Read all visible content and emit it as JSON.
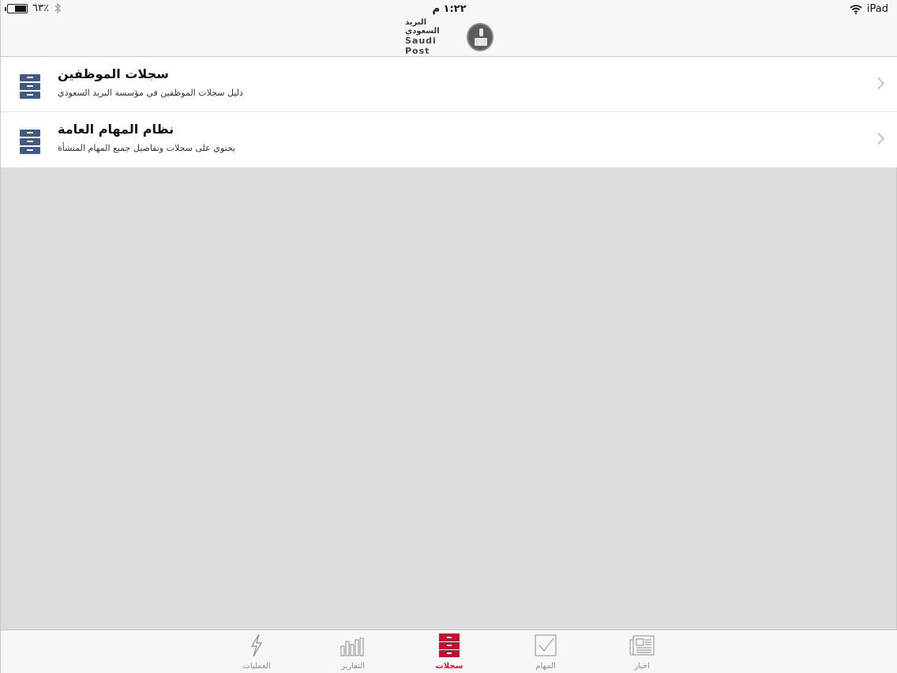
{
  "status_bar": {
    "device": "iPad",
    "time": "١:٢٢ م",
    "battery": "٦٣٪",
    "battery_level": 0.63
  },
  "nav_bar": {
    "logo_arabic": "البريد السعودي",
    "logo_english": "Saudi Post"
  },
  "list": {
    "items": [
      {
        "title": "سجلات الموظفين",
        "subtitle": "دليل سجلات الموظفين في مؤسسة البريد السعودي",
        "icon": "file-cabinet-icon"
      },
      {
        "title": "نظام المهام العامة",
        "subtitle": "يحتوي على سجلات وتفاصيل جميع المهام المنشأة",
        "icon": "file-cabinet-icon"
      }
    ]
  },
  "tab_bar": {
    "accent_color": "#c8102e",
    "inactive_color": "#8e8e93",
    "tabs": [
      {
        "label": "العمليات",
        "icon": "lightning-icon",
        "active": false
      },
      {
        "label": "التقارير",
        "icon": "bar-chart-icon",
        "active": false
      },
      {
        "label": "سجلات",
        "icon": "file-cabinet-icon",
        "active": true
      },
      {
        "label": "المهام",
        "icon": "checkbox-icon",
        "active": false
      },
      {
        "label": "اخبار",
        "icon": "newspaper-icon",
        "active": false
      }
    ]
  }
}
